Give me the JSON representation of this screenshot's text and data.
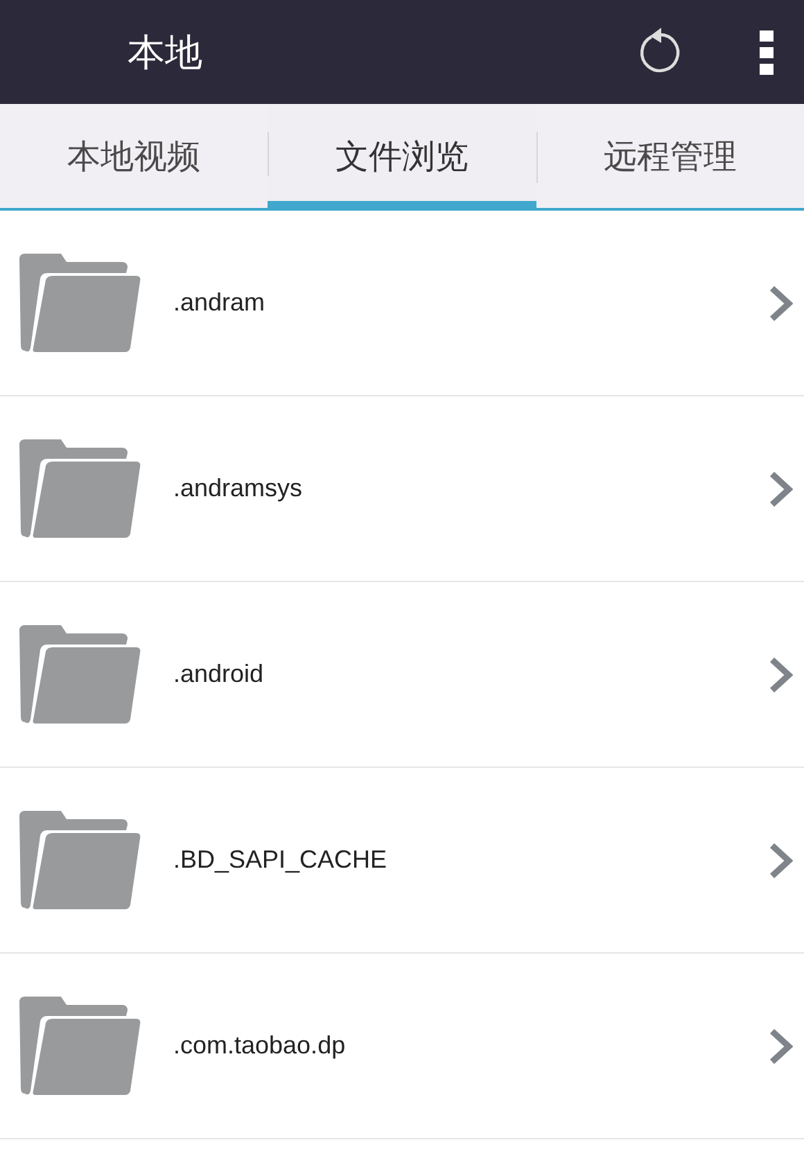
{
  "app_bar": {
    "title": "本地"
  },
  "tabs": [
    {
      "label": "本地视频",
      "selected": false
    },
    {
      "label": "文件浏览",
      "selected": true
    },
    {
      "label": "远程管理",
      "selected": false
    }
  ],
  "folders": [
    {
      "name": ".andram"
    },
    {
      "name": ".andramsys"
    },
    {
      "name": ".android"
    },
    {
      "name": ".BD_SAPI_CACHE"
    },
    {
      "name": ".com.taobao.dp"
    }
  ]
}
